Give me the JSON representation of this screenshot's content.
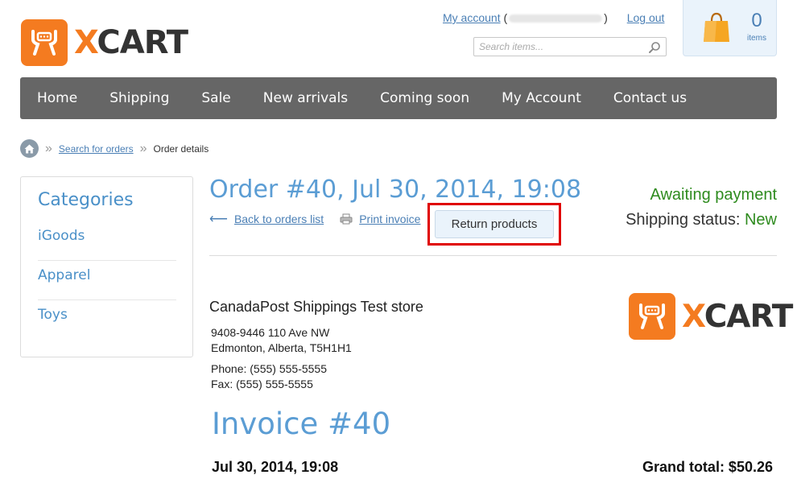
{
  "brand": {
    "logo_x": "X",
    "logo_cart": "CART",
    "accent_color": "#f47b20",
    "nav_color": "#666666",
    "link_color": "#4a7fb5",
    "heading_color": "#5b9dd4",
    "status_color": "#2e8b1e",
    "highlight_color": "#e00000"
  },
  "header": {
    "my_account": "My account",
    "paren_open": "(",
    "paren_close": ")",
    "logout": "Log out",
    "search_placeholder": "Search items...",
    "cart_count": "0",
    "cart_items_label": "items"
  },
  "nav": {
    "items": [
      "Home",
      "Shipping",
      "Sale",
      "New arrivals",
      "Coming soon",
      "My Account",
      "Contact us"
    ]
  },
  "breadcrumb": {
    "sep": "»",
    "link": "Search for orders",
    "current": "Order details"
  },
  "sidebar": {
    "title": "Categories",
    "items": [
      "iGoods",
      "Apparel",
      "Toys"
    ]
  },
  "order": {
    "title": "Order #40, Jul 30, 2014, 19:08",
    "status": "Awaiting payment",
    "shipping_label": "Shipping status:",
    "shipping_value": "New",
    "back_link": "Back to orders list",
    "print_link": "Print invoice",
    "return_button": "Return products"
  },
  "store": {
    "name": "CanadaPost Shippings Test store",
    "address_line1": "9408-9446 110 Ave NW",
    "address_line2": "Edmonton, Alberta, T5H1H1",
    "phone": "Phone: (555) 555-5555",
    "fax": "Fax: (555) 555-5555"
  },
  "invoice": {
    "title": "Invoice #40",
    "date": "Jul 30, 2014, 19:08",
    "grand_total": "Grand total: $50.26"
  }
}
